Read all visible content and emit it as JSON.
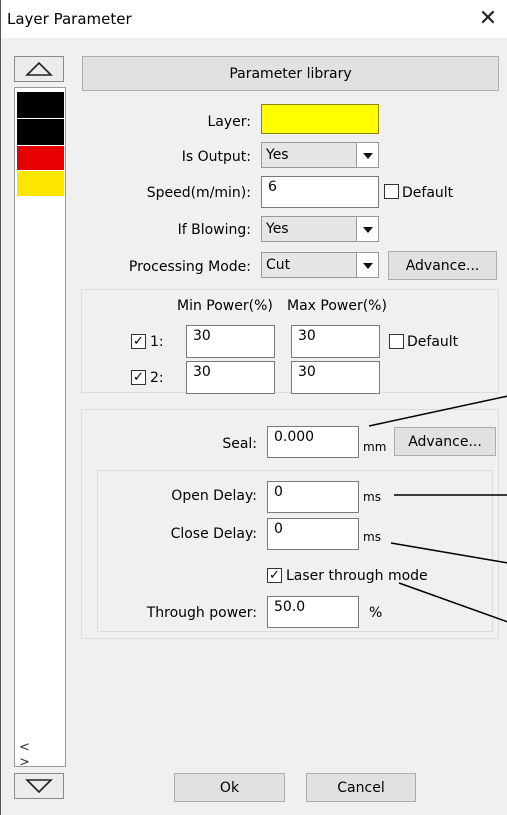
{
  "window": {
    "title": "Layer Parameter"
  },
  "sidebar": {
    "layer_colors": [
      "#000000",
      "#000000",
      "#e60000",
      "#ffe600"
    ],
    "scroll_arrows": "< >"
  },
  "library_button": "Parameter library",
  "layer": {
    "label": "Layer:",
    "color": "#ffff00"
  },
  "is_output": {
    "label": "Is Output:",
    "value": "Yes"
  },
  "speed": {
    "label": "Speed(m/min):",
    "value": "6",
    "default_label": "Default"
  },
  "if_blowing": {
    "label": "If Blowing:",
    "value": "Yes"
  },
  "processing_mode": {
    "label": "Processing Mode:",
    "value": "Cut",
    "advance_label": "Advance..."
  },
  "power": {
    "min_header": "Min Power(%)",
    "max_header": "Max Power(%)",
    "default_label": "Default",
    "rows": [
      {
        "label": "1:",
        "checked": true,
        "min": "30",
        "max": "30"
      },
      {
        "label": "2:",
        "checked": true,
        "min": "30",
        "max": "30"
      }
    ]
  },
  "seal": {
    "label": "Seal:",
    "value": "0.000",
    "unit": "mm",
    "advance_label": "Advance..."
  },
  "open_delay": {
    "label": "Open Delay:",
    "value": "0",
    "unit": "ms"
  },
  "close_delay": {
    "label": "Close Delay:",
    "value": "0",
    "unit": "ms"
  },
  "laser_through": {
    "label": "Laser through mode",
    "checked": true
  },
  "through_power": {
    "label": "Through power:",
    "value": "50.0",
    "unit": "%"
  },
  "footer": {
    "ok_label": "Ok",
    "cancel_label": "Cancel"
  }
}
